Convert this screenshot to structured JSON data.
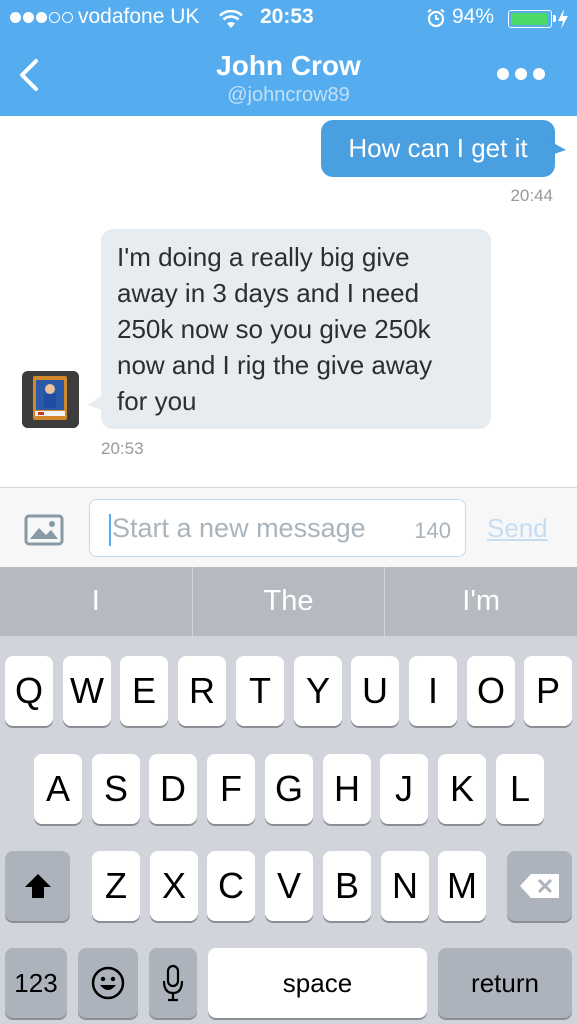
{
  "status_bar": {
    "carrier": "vodafone UK",
    "time": "20:53",
    "battery_percent": "94%",
    "battery_level": 0.94,
    "signal_bars_filled": 3,
    "signal_bars_total": 5
  },
  "header": {
    "title": "John Crow",
    "handle": "@johncrow89"
  },
  "messages": [
    {
      "direction": "outgoing",
      "text": "How can I get it",
      "time": "20:44"
    },
    {
      "direction": "incoming",
      "lines": [
        "I'm doing a really big give",
        "away in 3 days and I need",
        "250k now so you give 250k",
        "now and I rig the give away",
        "for you"
      ],
      "time": "20:53"
    }
  ],
  "composer": {
    "placeholder": "Start a new message",
    "char_count": "140",
    "send_label": "Send"
  },
  "keyboard": {
    "suggestions": [
      "I",
      "The",
      "I'm"
    ],
    "row1": [
      "Q",
      "W",
      "E",
      "R",
      "T",
      "Y",
      "U",
      "I",
      "O",
      "P"
    ],
    "row2": [
      "A",
      "S",
      "D",
      "F",
      "G",
      "H",
      "J",
      "K",
      "L"
    ],
    "row3": [
      "Z",
      "X",
      "C",
      "V",
      "B",
      "N",
      "M"
    ],
    "numbers_label": "123",
    "space_label": "space",
    "return_label": "return"
  },
  "colors": {
    "header": "#55acee",
    "outgoing_bubble": "#4a9fe0",
    "incoming_bubble": "#e6ecf0",
    "battery": "#4cd964"
  },
  "icons": [
    "wifi-icon",
    "alarm-icon",
    "battery-icon",
    "charging-icon",
    "back-chevron-icon",
    "more-icon",
    "image-icon",
    "shift-icon",
    "backspace-icon",
    "emoji-icon",
    "microphone-icon"
  ]
}
